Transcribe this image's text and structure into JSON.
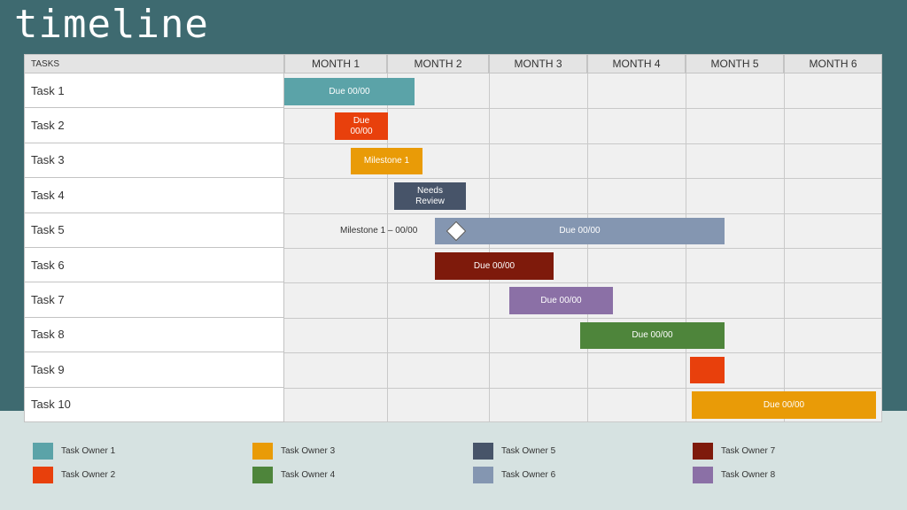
{
  "title": "timeline",
  "tasks_header": "TASKS",
  "months": [
    "MONTH 1",
    "MONTH 2",
    "MONTH 3",
    "MONTH 4",
    "MONTH 5",
    "MONTH 6"
  ],
  "tasks": [
    "Task 1",
    "Task 2",
    "Task 3",
    "Task 4",
    "Task 5",
    "Task 6",
    "Task 7",
    "Task 8",
    "Task 9",
    "Task 10"
  ],
  "bars": [
    {
      "task": "Task 1",
      "label": "Due 00/00",
      "color": "#5ba3a8",
      "owner": "Task Owner 1"
    },
    {
      "task": "Task 2",
      "label": "Due\n00/00",
      "color": "#e8400c",
      "owner": "Task Owner 2"
    },
    {
      "task": "Task 3",
      "label": "Milestone 1",
      "color": "#e99b07",
      "owner": "Task Owner 3"
    },
    {
      "task": "Task 4",
      "label": "Needs\nReview",
      "color": "#475469",
      "owner": "Task Owner 5"
    },
    {
      "task": "Task 5",
      "label": "Due 00/00",
      "color": "#8496b1",
      "owner": "Task Owner 6"
    },
    {
      "task": "Task 6",
      "label": "Due 00/00",
      "color": "#7e1a0b",
      "owner": "Task Owner 7"
    },
    {
      "task": "Task 7",
      "label": "Due 00/00",
      "color": "#8b70a6",
      "owner": "Task Owner 8"
    },
    {
      "task": "Task 8",
      "label": "Due 00/00",
      "color": "#4e853b",
      "owner": "Task Owner 4"
    },
    {
      "task": "Task 9",
      "label": "",
      "color": "#e8400c",
      "owner": "Task Owner 2"
    },
    {
      "task": "Task 10",
      "label": "Due 00/00",
      "color": "#e99b07",
      "owner": "Task Owner 3"
    }
  ],
  "milestone": {
    "task": "Task 5",
    "label": "Milestone 1 – 00/00"
  },
  "legend": [
    {
      "label": "Task Owner 1",
      "color": "#5ba3a8"
    },
    {
      "label": "Task Owner 2",
      "color": "#e8400c"
    },
    {
      "label": "Task Owner 3",
      "color": "#e99b07"
    },
    {
      "label": "Task Owner 4",
      "color": "#4e853b"
    },
    {
      "label": "Task Owner 5",
      "color": "#475469"
    },
    {
      "label": "Task Owner 6",
      "color": "#8496b1"
    },
    {
      "label": "Task Owner 7",
      "color": "#7e1a0b"
    },
    {
      "label": "Task Owner 8",
      "color": "#8b70a6"
    }
  ]
}
